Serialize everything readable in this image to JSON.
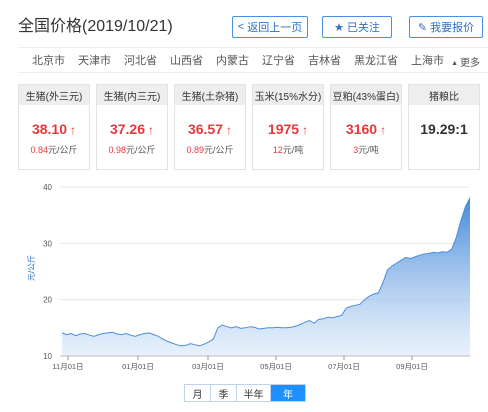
{
  "header": {
    "title": "全国价格(2019/10/21)",
    "back_label": "返回上一页",
    "follow_label": "已关注",
    "report_label": "我要报价",
    "icons": {
      "back": "chevron-left-icon",
      "follow": "star-icon",
      "report": "edit-icon"
    }
  },
  "regions": {
    "items": [
      "北京市",
      "天津市",
      "河北省",
      "山西省",
      "内蒙古",
      "辽宁省",
      "吉林省",
      "黑龙江省",
      "上海市"
    ],
    "more_label": "更多"
  },
  "cards": [
    {
      "name": "生猪(外三元)",
      "price": "38.10",
      "change": "0.84",
      "unit": "元/公斤"
    },
    {
      "name": "生猪(内三元)",
      "price": "37.26",
      "change": "0.98",
      "unit": "元/公斤"
    },
    {
      "name": "生猪(土杂猪)",
      "price": "36.57",
      "change": "0.89",
      "unit": "元/公斤"
    },
    {
      "name": "玉米(15%水分)",
      "price": "1975",
      "change": "12",
      "unit": "元/吨"
    },
    {
      "name": "豆粕(43%蛋白)",
      "price": "3160",
      "change": "3",
      "unit": "元/吨"
    },
    {
      "name": "猪粮比",
      "price": "19.29:1"
    }
  ],
  "up_arrow": "↑",
  "accent_colors": {
    "up": "#e4393c",
    "line": "#4a8fe0",
    "active": "#1e90ff"
  },
  "chart_data": {
    "type": "area",
    "ylabel": "元/公斤",
    "ylim": [
      10,
      40
    ],
    "yticks": [
      10,
      20,
      30,
      40
    ],
    "xticks": [
      "11月01日",
      "01月01日",
      "03月01日",
      "05月01日",
      "07月01日",
      "09月01日"
    ],
    "series": [
      {
        "values": [
          14.1,
          13.8,
          14.0,
          13.6,
          13.9,
          14.0,
          13.7,
          13.5,
          13.8,
          14.0,
          14.1,
          14.2,
          13.9,
          13.8,
          14.0,
          13.7,
          13.5,
          13.8,
          14.0,
          14.1,
          13.8,
          13.5,
          13.0,
          12.6,
          12.3,
          12.0,
          11.8,
          11.9,
          12.2,
          12.0,
          11.8,
          12.1,
          12.5,
          13.0,
          15.0,
          15.5,
          15.2,
          15.0,
          15.2,
          14.9,
          15.0,
          15.2,
          15.1,
          14.8,
          14.9,
          15.0,
          15.0,
          15.1,
          15.0,
          15.0,
          15.1,
          15.3,
          15.6,
          16.0,
          16.3,
          15.8,
          16.5,
          16.6,
          16.9,
          16.8,
          17.0,
          17.2,
          18.5,
          18.8,
          19.0,
          19.2,
          20.0,
          20.6,
          21.0,
          21.2,
          23.0,
          25.3,
          26.0,
          26.5,
          27.0,
          27.5,
          27.3,
          27.6,
          27.9,
          28.1,
          28.2,
          28.4,
          28.3,
          28.5,
          28.4,
          29.0,
          31.0,
          34.0,
          36.5,
          38.1
        ]
      }
    ]
  },
  "ranges": [
    "月",
    "季",
    "半年",
    "年"
  ],
  "active_range": "年"
}
